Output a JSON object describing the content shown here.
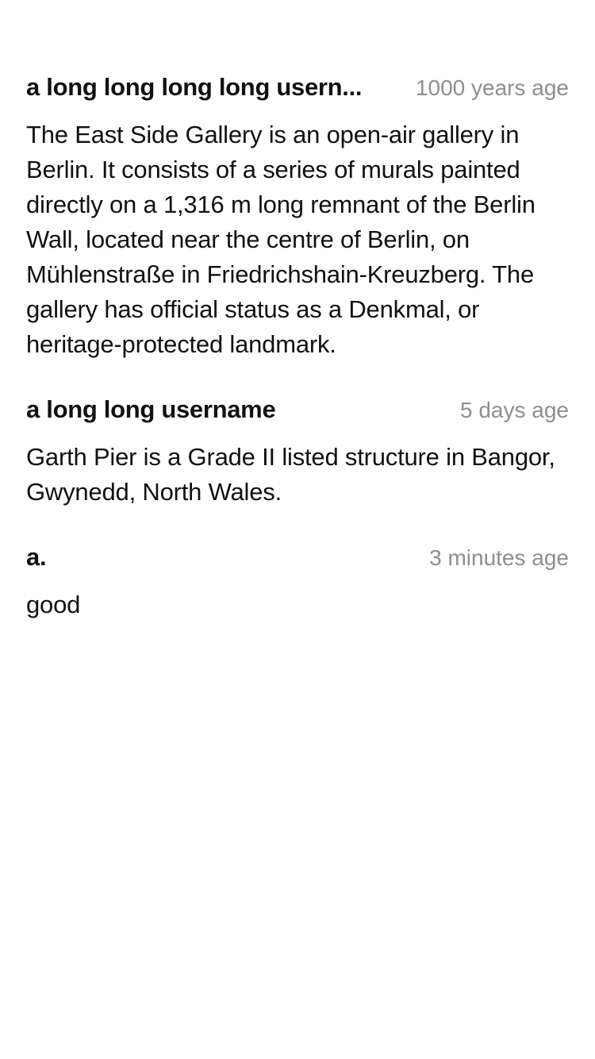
{
  "comments": [
    {
      "username": "a long long long long usern...",
      "timestamp": "1000 years age",
      "body": "The East Side Gallery is an open-air gallery in Berlin. It consists of a series of murals painted directly on a 1,316 m long remnant of the Berlin Wall, located near the centre of Berlin, on Mühlenstraße in Friedrichshain-Kreuzberg. The gallery has official status as a Denkmal, or heritage-protected landmark."
    },
    {
      "username": "a long long username",
      "timestamp": "5 days age",
      "body": "Garth Pier is a Grade II listed structure in Bangor, Gwynedd, North Wales."
    },
    {
      "username": "a.",
      "timestamp": "3 minutes age",
      "body": "good"
    }
  ]
}
